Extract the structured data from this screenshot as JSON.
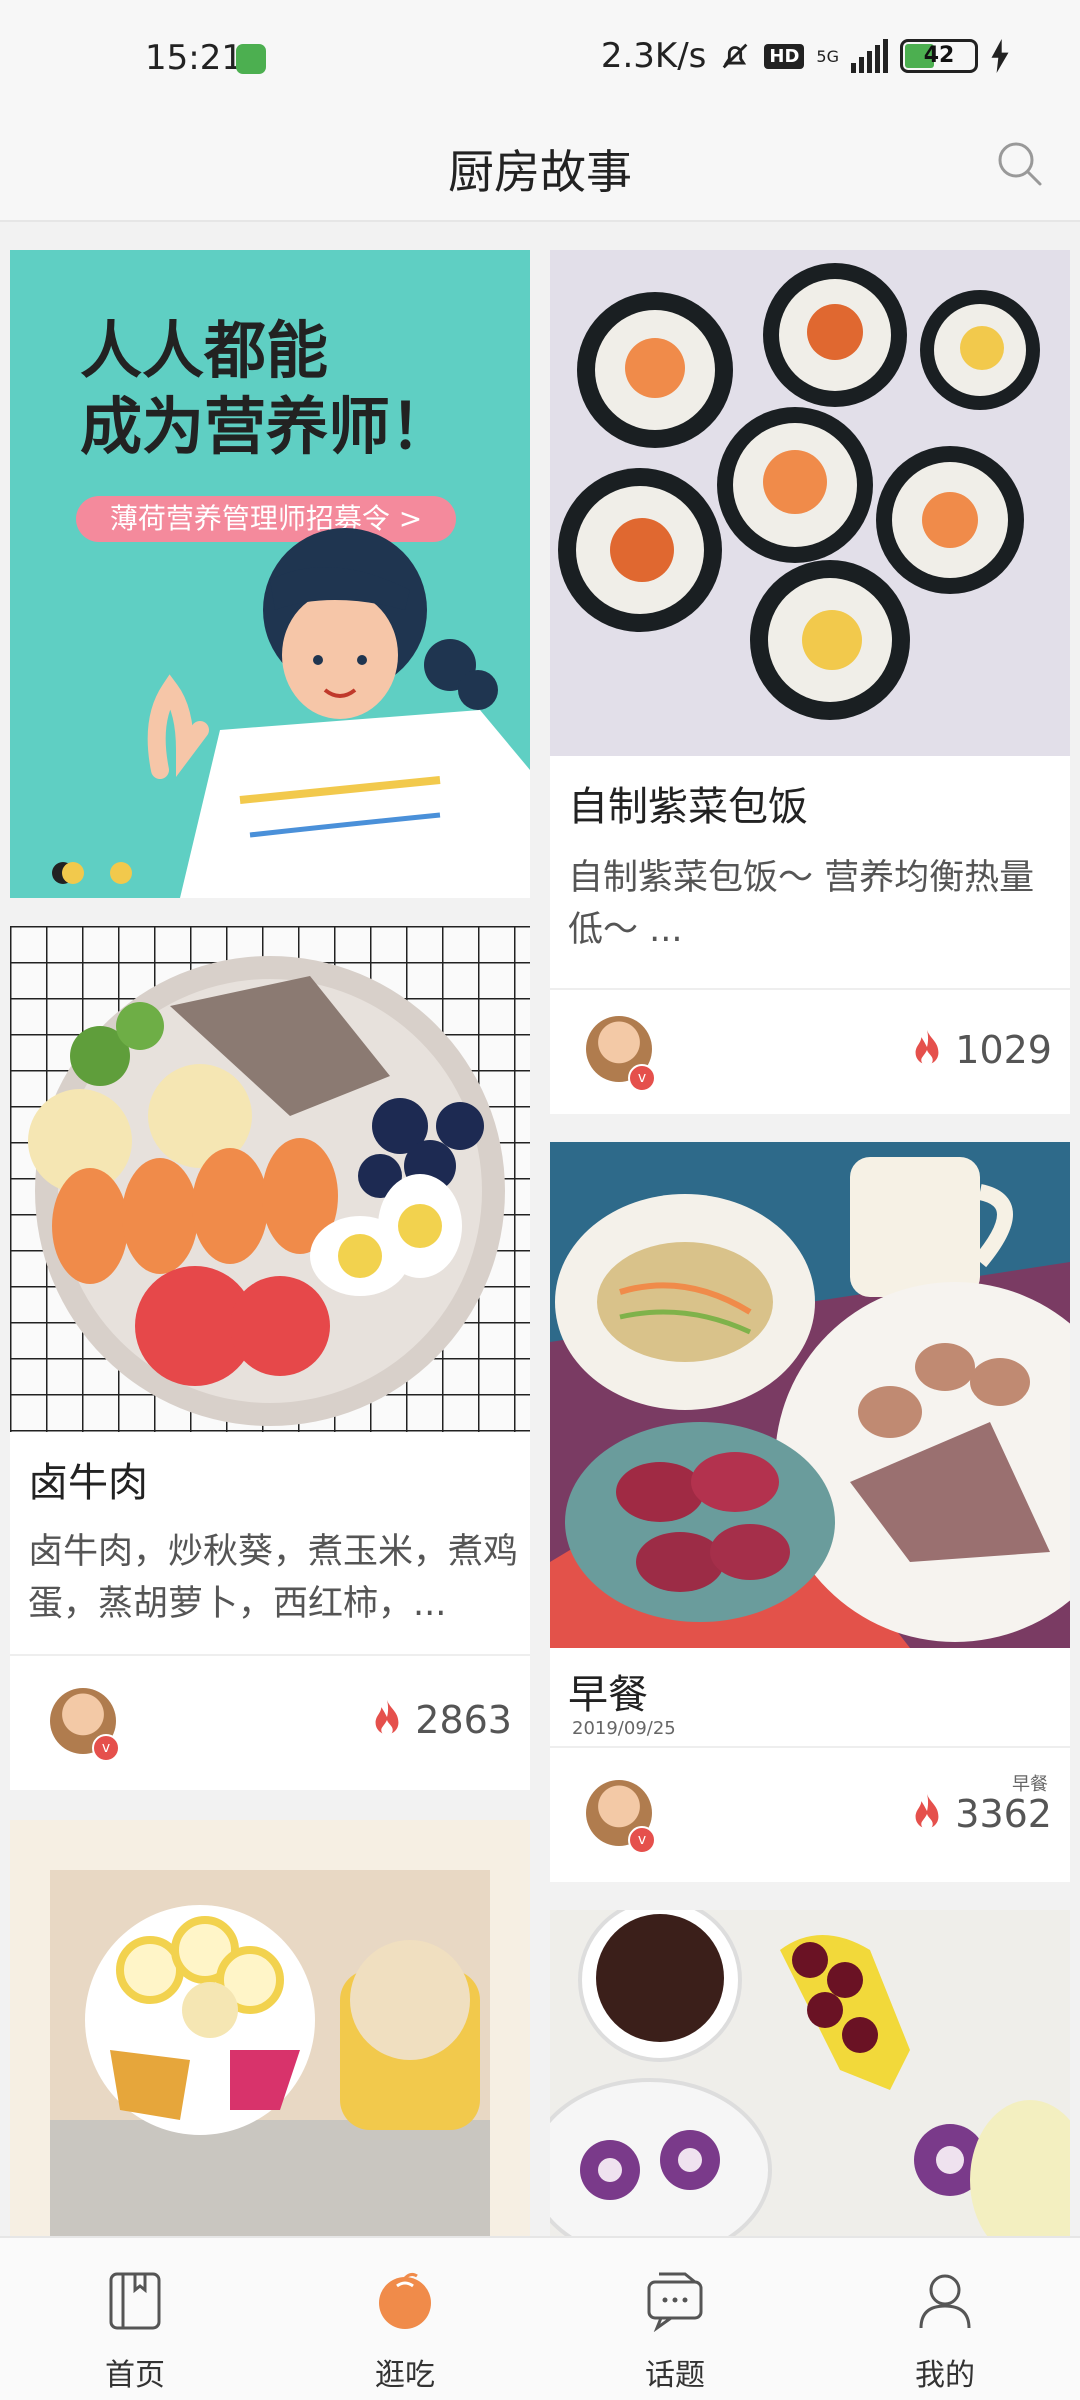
{
  "status_bar": {
    "time": "15:21",
    "network_speed": "2.3K/s",
    "hd": "HD",
    "network_type": "5G",
    "battery": "42"
  },
  "header": {
    "title": "厨房故事"
  },
  "banner": {
    "line1": "人人都能",
    "line2": "成为营养师！",
    "pill": "薄荷营养管理师招募令 >"
  },
  "cards": [
    {
      "title": "自制紫菜包饭",
      "desc": "自制紫菜包饭～ 营养均衡热量低～ ...",
      "count": "1029"
    },
    {
      "title": "卤牛肉",
      "desc": "卤牛肉，炒秋葵，煮玉米，煮鸡蛋，蒸胡萝卜，西红柿，...",
      "count": "2863"
    },
    {
      "title": "早餐",
      "date": "2019/09/25",
      "tag": "早餐",
      "count": "3362"
    }
  ],
  "tabbar": {
    "tabs": [
      {
        "label": "首页"
      },
      {
        "label": "逛吃"
      },
      {
        "label": "话题"
      },
      {
        "label": "我的"
      }
    ]
  },
  "colors": {
    "accent": "#e5504c",
    "brand_orange": "#f08b4a",
    "banner_bg": "#5fcfc3"
  }
}
